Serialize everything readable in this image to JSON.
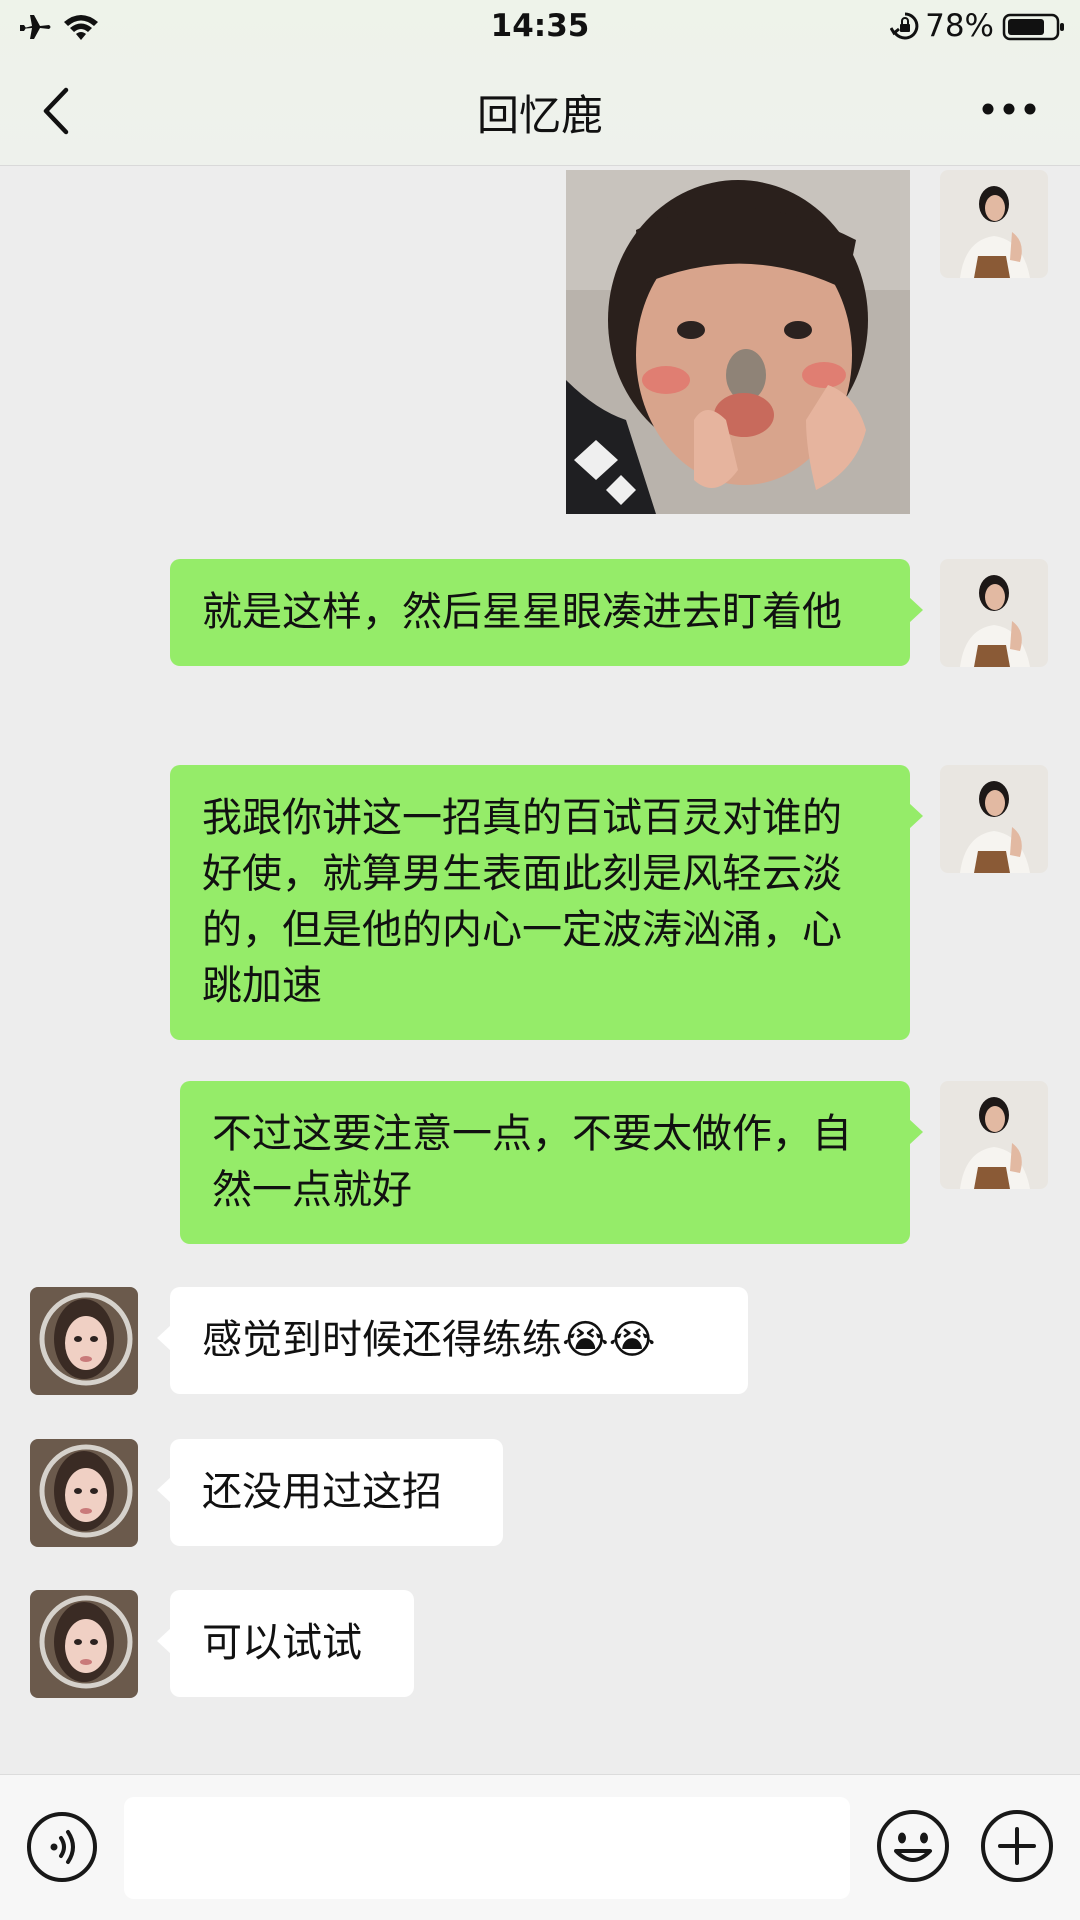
{
  "status_bar": {
    "time": "14:35",
    "battery": "78%",
    "icons": [
      "airplane-icon",
      "wifi-icon",
      "lock-rotation-icon",
      "battery-icon"
    ]
  },
  "header": {
    "title": "回忆鹿",
    "back_icon": "chevron-left-icon",
    "more_icon": "more-dots-icon"
  },
  "messages": [
    {
      "from": "self",
      "type": "image",
      "content": "sticker: child blowing a kiss"
    },
    {
      "from": "self",
      "type": "text",
      "text": "就是这样，然后星星眼凑进去盯着他"
    },
    {
      "from": "self",
      "type": "text",
      "text": "我跟你讲这一招真的百试百灵对谁的好使，就算男生表面此刻是风轻云淡的，但是他的内心一定波涛汹涌，心跳加速"
    },
    {
      "from": "self",
      "type": "text",
      "text": "不过这要注意一点，不要太做作，自然一点就好"
    },
    {
      "from": "other",
      "type": "text",
      "text": "感觉到时候还得练练😭😭"
    },
    {
      "from": "other",
      "type": "text",
      "text": "还没用过这招"
    },
    {
      "from": "other",
      "type": "text",
      "text": "可以试试"
    }
  ],
  "input_bar": {
    "voice_icon": "voice-icon",
    "emoji_icon": "emoji-icon",
    "plus_icon": "plus-icon",
    "placeholder": ""
  },
  "colors": {
    "self_bubble": "#95ec69",
    "other_bubble": "#ffffff",
    "background": "#ededed"
  }
}
